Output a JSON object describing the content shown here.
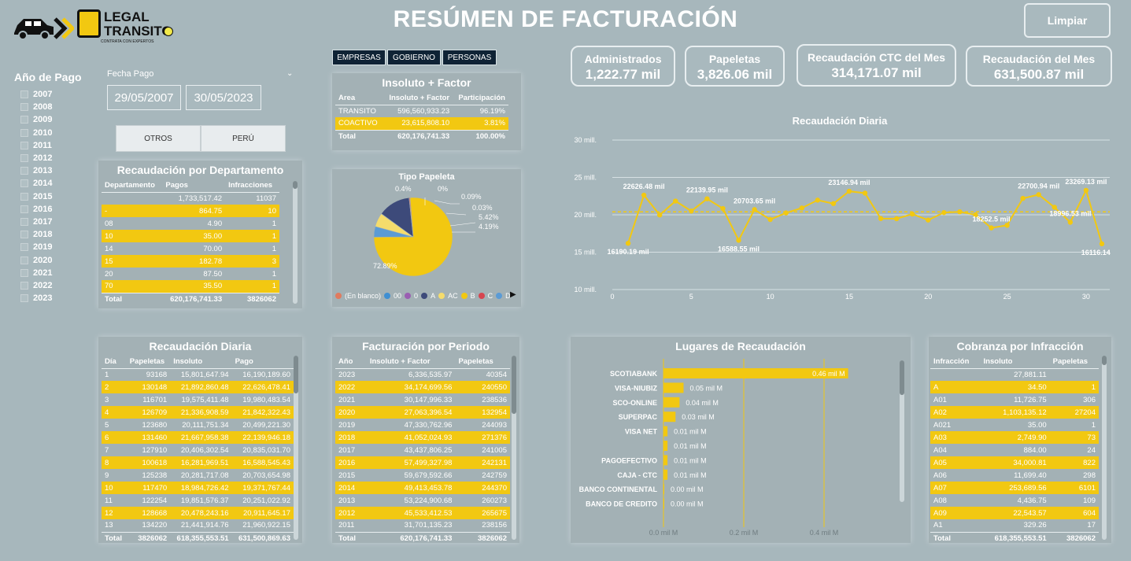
{
  "header": {
    "title": "RESÚMEN DE FACTURACIÓN",
    "clear_label": "Limpiar",
    "logo_line1": "LEGAL",
    "logo_line2": "TRANSITO",
    "logo_tagline": "CONTRATA CON EXPERTOS"
  },
  "kpis": [
    {
      "label": "Administrados",
      "value": "1,222.77 mil"
    },
    {
      "label": "Papeletas",
      "value": "3,826.06 mil"
    },
    {
      "label": "Recaudación CTC del Mes",
      "value": "314,171.07 mil"
    },
    {
      "label": "Recaudación del Mes",
      "value": "631,500.87 mil"
    }
  ],
  "year_filter": {
    "title": "Año de Pago",
    "years": [
      "2007",
      "2008",
      "2009",
      "2010",
      "2011",
      "2012",
      "2013",
      "2014",
      "2015",
      "2016",
      "2017",
      "2018",
      "2019",
      "2020",
      "2021",
      "2022",
      "2023"
    ]
  },
  "date_filter": {
    "label": "Fecha Pago",
    "from": "29/05/2007",
    "to": "30/05/2023"
  },
  "segment_buttons": [
    "EMPRESAS",
    "GOBIERNO",
    "PERSONAS"
  ],
  "region_buttons": [
    "OTROS",
    "PERÚ"
  ],
  "insoluto": {
    "title": "Insoluto + Factor",
    "headers": [
      "Area",
      "Insoluto + Factor",
      "Participación"
    ],
    "rows": [
      [
        "TRANSITO",
        "596,560,933.23",
        "96.19%"
      ],
      [
        "COACTIVO",
        "23,615,808.10",
        "3.81%"
      ]
    ],
    "total": [
      "Total",
      "620,176,741.33",
      "100.00%"
    ]
  },
  "departamento": {
    "title": "Recaudación por Departamento",
    "headers": [
      "Departamento",
      "Pagos",
      "Infracciones"
    ],
    "rows": [
      [
        "",
        "1,733,517.42",
        "11037"
      ],
      [
        "-",
        "864.75",
        "10"
      ],
      [
        "08",
        "4.90",
        "1"
      ],
      [
        "10",
        "35.00",
        "1"
      ],
      [
        "14",
        "70.00",
        "1"
      ],
      [
        "15",
        "182.78",
        "3"
      ],
      [
        "20",
        "87.50",
        "1"
      ],
      [
        "70",
        "35.50",
        "1"
      ]
    ],
    "total": [
      "Total",
      "620,176,741.33",
      "3826062"
    ]
  },
  "tipo_papeleta": {
    "title": "Tipo Papeleta",
    "legend": [
      {
        "name": "(En blanco)",
        "color": "#e07b5f"
      },
      {
        "name": "00",
        "color": "#3f8fd2"
      },
      {
        "name": "0",
        "color": "#9a5fb2"
      },
      {
        "name": "A",
        "color": "#3d4a7a"
      },
      {
        "name": "AC",
        "color": "#f5dc6c"
      },
      {
        "name": "B",
        "color": "#f2c811"
      },
      {
        "name": "C",
        "color": "#d64550"
      },
      {
        "name": "D",
        "color": "#5b9bd5"
      }
    ],
    "labels": [
      "0.4%",
      "0%",
      "0.09%",
      "0.03%",
      "5.42%",
      "4.19%",
      "72.89%"
    ]
  },
  "chart_data": {
    "type": "line",
    "title": "Recaudación Diaria",
    "x": [
      1,
      2,
      3,
      4,
      5,
      6,
      7,
      8,
      9,
      10,
      11,
      12,
      13,
      14,
      15,
      16,
      17,
      18,
      19,
      20,
      21,
      22,
      23,
      24,
      25,
      26,
      27,
      28,
      29,
      30,
      31
    ],
    "values": [
      16.19,
      22.63,
      19.98,
      21.84,
      20.5,
      22.14,
      20.84,
      16.59,
      20.7,
      19.37,
      20.25,
      20.91,
      21.96,
      21.5,
      23.15,
      22.9,
      19.5,
      19.48,
      20.1,
      19.3,
      20.3,
      20.4,
      20.0,
      18.25,
      18.6,
      22.2,
      22.7,
      21.0,
      19.0,
      23.27,
      16.12
    ],
    "labels": {
      "1": "16190.19 mil",
      "2": "22626.48 mil",
      "6": "22139.95 mil",
      "8": "16588.55 mil",
      "9": "20703.65 mil",
      "15": "23146.94 mil",
      "24": "18252.5 mil",
      "27": "22700.94 mil",
      "29": "18996.53 mil",
      "30": "23269.13 mil",
      "31": "16116.14 mil"
    },
    "average": 20.4,
    "ylim": [
      10,
      30
    ],
    "yticks": [
      "10 mill.",
      "15 mill.",
      "20 mill.",
      "25 mill.",
      "30 mill."
    ],
    "xticks": [
      "0",
      "5",
      "10",
      "15",
      "20",
      "25",
      "30"
    ]
  },
  "diaria_table": {
    "title": "Recaudación Diaria",
    "headers": [
      "Día",
      "Papeletas",
      "Insoluto",
      "Pago"
    ],
    "rows": [
      [
        "1",
        "93168",
        "15,801,647.94",
        "16,190,189.60"
      ],
      [
        "2",
        "130148",
        "21,892,860.48",
        "22,626,478.41"
      ],
      [
        "3",
        "116701",
        "19,575,411.48",
        "19,980,483.54"
      ],
      [
        "4",
        "126709",
        "21,336,908.59",
        "21,842,322.43"
      ],
      [
        "5",
        "123680",
        "20,111,751.34",
        "20,499,221.30"
      ],
      [
        "6",
        "131460",
        "21,667,958.38",
        "22,139,946.18"
      ],
      [
        "7",
        "127910",
        "20,406,302.54",
        "20,835,031.70"
      ],
      [
        "8",
        "100618",
        "16,281,969.51",
        "16,588,545.43"
      ],
      [
        "9",
        "125238",
        "20,281,717.08",
        "20,703,654.98"
      ],
      [
        "10",
        "117470",
        "18,984,726.42",
        "19,371,767.44"
      ],
      [
        "11",
        "122254",
        "19,851,576.37",
        "20,251,022.92"
      ],
      [
        "12",
        "128668",
        "20,478,243.16",
        "20,911,645.17"
      ],
      [
        "13",
        "134220",
        "21,441,914.76",
        "21,960,922.15"
      ]
    ],
    "total": [
      "Total",
      "3826062",
      "618,355,553.51",
      "631,500,869.63"
    ]
  },
  "periodo": {
    "title": "Facturación por Periodo",
    "headers": [
      "Año",
      "Insoluto + Factor",
      "Papeletas"
    ],
    "rows": [
      [
        "2023",
        "6,336,535.97",
        "40354"
      ],
      [
        "2022",
        "34,174,699.56",
        "240550"
      ],
      [
        "2021",
        "30,147,996.33",
        "238536"
      ],
      [
        "2020",
        "27,063,396.54",
        "132954"
      ],
      [
        "2019",
        "47,330,762.96",
        "244093"
      ],
      [
        "2018",
        "41,052,024.93",
        "271376"
      ],
      [
        "2017",
        "43,437,806.25",
        "241005"
      ],
      [
        "2016",
        "57,499,327.98",
        "242131"
      ],
      [
        "2015",
        "59,679,592.66",
        "242759"
      ],
      [
        "2014",
        "49,413,453.78",
        "244370"
      ],
      [
        "2013",
        "53,224,900.68",
        "260273"
      ],
      [
        "2012",
        "45,533,412.53",
        "265675"
      ],
      [
        "2011",
        "31,701,135.23",
        "238156"
      ]
    ],
    "total": [
      "Total",
      "620,176,741.33",
      "3826062"
    ]
  },
  "lugares": {
    "title": "Lugares de Recaudación",
    "items": [
      {
        "name": "SCOTIABANK",
        "value": 0.46,
        "label": "0.46 mil M"
      },
      {
        "name": "VISA-NIUBIZ",
        "value": 0.05,
        "label": "0.05 mil M"
      },
      {
        "name": "SCO-ONLINE",
        "value": 0.04,
        "label": "0.04 mil M"
      },
      {
        "name": "SUPERPAC",
        "value": 0.03,
        "label": "0.03 mil M"
      },
      {
        "name": "VISA NET",
        "value": 0.01,
        "label": "0.01 mil M"
      },
      {
        "name": "",
        "value": 0.01,
        "label": "0.01 mil M"
      },
      {
        "name": "PAGOEFECTIVO",
        "value": 0.01,
        "label": "0.01 mil M"
      },
      {
        "name": "CAJA - CTC",
        "value": 0.01,
        "label": "0.01 mil M"
      },
      {
        "name": "BANCO CONTINENTAL",
        "value": 0.0,
        "label": "0.00 mil M"
      },
      {
        "name": "BANCO DE CREDITO",
        "value": 0.0,
        "label": "0.00 mil M"
      }
    ],
    "xticks": [
      "0.0 mil M",
      "0.2 mil M",
      "0.4 mil M"
    ]
  },
  "infraccion": {
    "title": "Cobranza por Infracción",
    "headers": [
      "Infracción",
      "Insoluto",
      "Papeletas"
    ],
    "rows": [
      [
        "",
        "27,881.11",
        ""
      ],
      [
        "A",
        "34.50",
        "1"
      ],
      [
        "A01",
        "11,726.75",
        "306"
      ],
      [
        "A02",
        "1,103,135.12",
        "27204"
      ],
      [
        "A021",
        "35.00",
        "1"
      ],
      [
        "A03",
        "2,749.90",
        "73"
      ],
      [
        "A04",
        "884.00",
        "24"
      ],
      [
        "A05",
        "34,000.81",
        "822"
      ],
      [
        "A06",
        "11,699.40",
        "298"
      ],
      [
        "A07",
        "253,689.56",
        "6101"
      ],
      [
        "A08",
        "4,436.75",
        "109"
      ],
      [
        "A09",
        "22,543.57",
        "604"
      ],
      [
        "A1",
        "329.26",
        "17"
      ]
    ],
    "total": [
      "Total",
      "618,355,553.51",
      "3826062"
    ]
  }
}
